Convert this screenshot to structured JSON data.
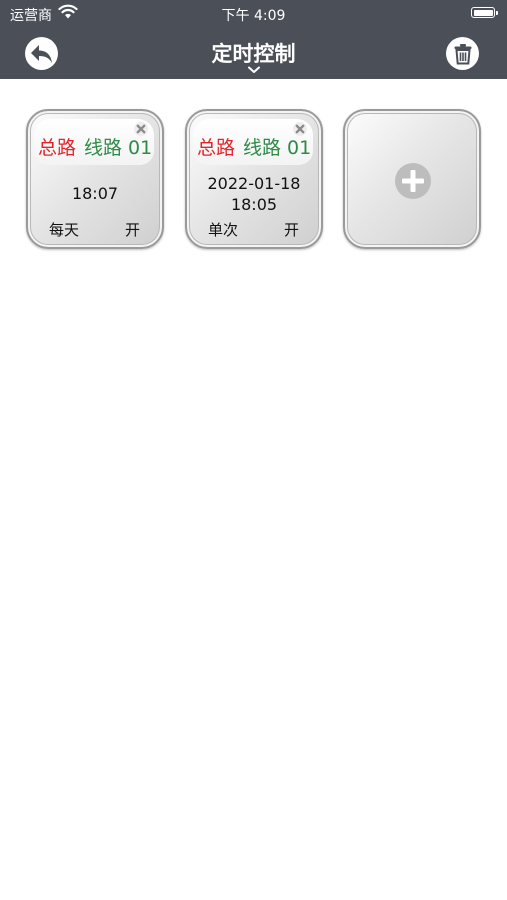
{
  "status_bar": {
    "carrier": "运营商",
    "time": "下午 4:09"
  },
  "nav": {
    "title": "定时控制",
    "back_icon": "back-arrow-icon",
    "trash_icon": "trash-icon"
  },
  "timers": [
    {
      "main_circuit": "总路",
      "line_circuit": "线路 01",
      "time": "18:07",
      "date": "",
      "repeat": "每天",
      "state": "开"
    },
    {
      "main_circuit": "总路",
      "line_circuit": "线路 01",
      "time": "18:05",
      "date": "2022-01-18",
      "repeat": "单次",
      "state": "开"
    }
  ],
  "add_card": {
    "icon": "plus-circle-icon"
  },
  "colors": {
    "nav_bg": "#4b4f57",
    "main_circuit": "#e3242b",
    "line_circuit": "#2e8b47",
    "plus": "#bdbdbd"
  }
}
